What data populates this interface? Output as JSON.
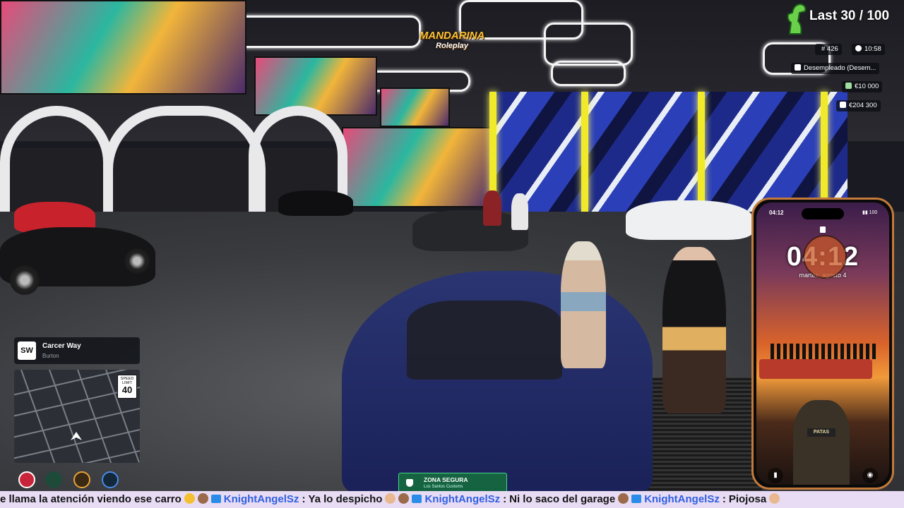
{
  "brand": {
    "name": "MANDARINA",
    "sub": "Roleplay"
  },
  "hud": {
    "counter": "Last 30 / 100",
    "player_id": "# 426",
    "clock": "10:58",
    "job": "Desempleado (Desem...",
    "cash": "€10 000",
    "bank": "€204 300"
  },
  "location": {
    "badge": "SW",
    "street": "Carcer Way",
    "zone": "Burton"
  },
  "speed_limit": {
    "label": "SPEED LIMIT",
    "value": "40"
  },
  "safe_zone": {
    "title": "ZONA SEGURA",
    "subtitle": "Los Santos Customs"
  },
  "phone": {
    "status_time": "04:12",
    "status": "▮▮ 100",
    "lock_time": "04:12",
    "date": "martes, agosto 4",
    "patch": "PATAS"
  },
  "chat": {
    "messages": [
      {
        "user": "",
        "text": "e llama la atención viendo ese carro"
      },
      {
        "user": "KnightAngelSz",
        "text": "Ya lo despicho"
      },
      {
        "user": "KnightAngelSz",
        "text": "Ni lo saco del garage"
      },
      {
        "user": "KnightAngelSz",
        "text": "Piojosa"
      }
    ]
  },
  "colors": {
    "ticker_bg": "#e8dcf4",
    "username": "#2f5fe0",
    "safe_zone": "#146e3c",
    "phone_frame": "#c47a3a"
  }
}
